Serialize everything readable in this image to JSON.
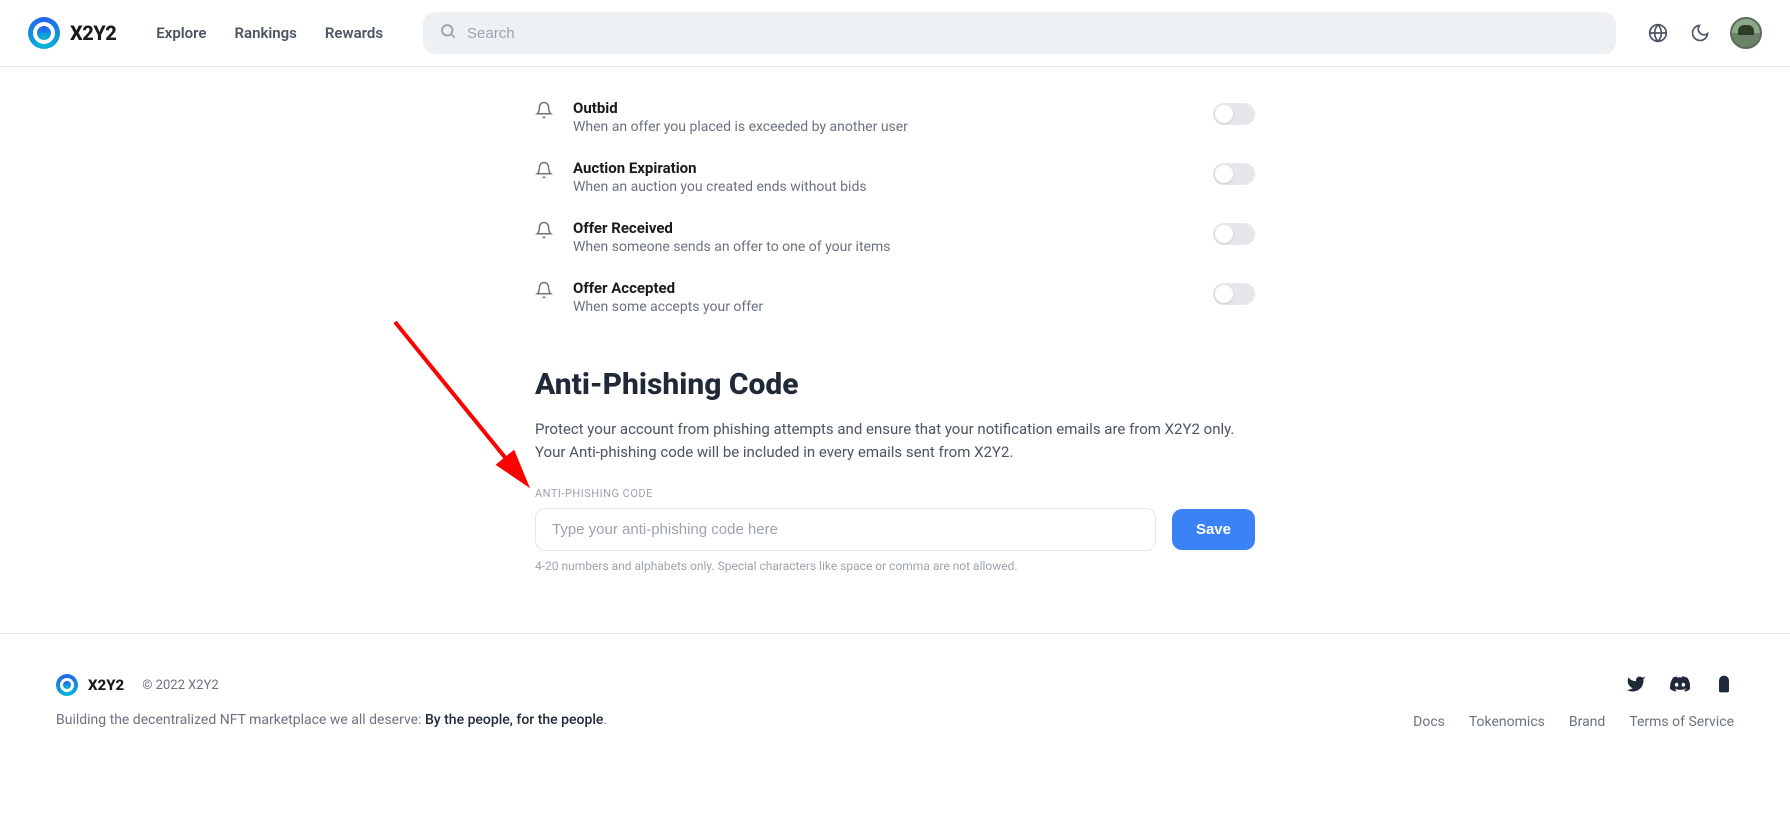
{
  "header": {
    "logo_text": "X2Y2",
    "nav": [
      "Explore",
      "Rankings",
      "Rewards"
    ],
    "search_placeholder": "Search"
  },
  "notifications": [
    {
      "title": "Outbid",
      "desc": "When an offer you placed is exceeded by another user"
    },
    {
      "title": "Auction Expiration",
      "desc": "When an auction you created ends without bids"
    },
    {
      "title": "Offer Received",
      "desc": "When someone sends an offer to one of your items"
    },
    {
      "title": "Offer Accepted",
      "desc": "When some accepts your offer"
    }
  ],
  "antiphishing": {
    "title": "Anti-Phishing Code",
    "desc": "Protect your account from phishing attempts and ensure that your notification emails are from X2Y2 only. Your Anti-phishing code will be included in every emails sent from X2Y2.",
    "field_label": "ANTI-PHISHING CODE",
    "placeholder": "Type your anti-phishing code here",
    "hint": "4-20 numbers and alphabets only. Special characters like space or comma are not allowed.",
    "save_label": "Save"
  },
  "footer": {
    "logo_text": "X2Y2",
    "copyright": "© 2022 X2Y2",
    "tagline_prefix": "Building the decentralized NFT marketplace we all deserve: ",
    "tagline_strong": "By the people, for the people",
    "links": [
      "Docs",
      "Tokenomics",
      "Brand",
      "Terms of Service"
    ]
  }
}
